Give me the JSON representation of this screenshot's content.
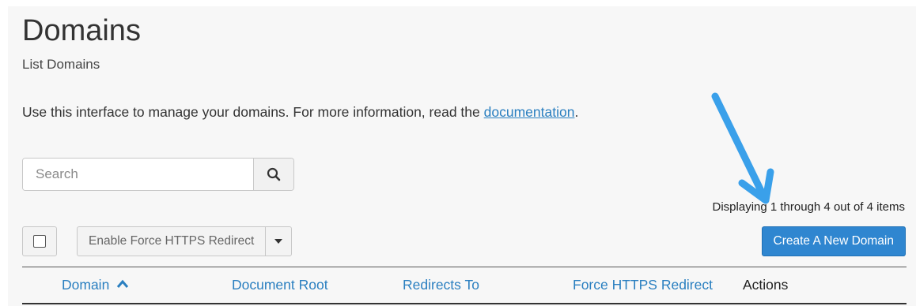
{
  "page": {
    "title": "Domains",
    "subtitle": "List Domains",
    "intro_text": "Use this interface to manage your domains. For more information, read the ",
    "intro_link": "documentation",
    "intro_end": "."
  },
  "search": {
    "placeholder": "Search",
    "value": "",
    "button_icon": "search-icon"
  },
  "pagination": {
    "text": "Displaying 1 through 4 out of 4 items"
  },
  "toolbar": {
    "bulk_action_label": "Enable Force HTTPS Redirect",
    "create_button_label": "Create A New Domain"
  },
  "table": {
    "columns": [
      {
        "label": "Domain",
        "sort_icon": "chevron-up-icon"
      },
      {
        "label": "Document Root"
      },
      {
        "label": "Redirects To"
      },
      {
        "label": "Force HTTPS Redirect"
      },
      {
        "label": "Actions"
      }
    ]
  },
  "colors": {
    "link": "#2a7fc0",
    "primary_button": "#2f86d0",
    "annotation_arrow": "#3aa0ea"
  }
}
